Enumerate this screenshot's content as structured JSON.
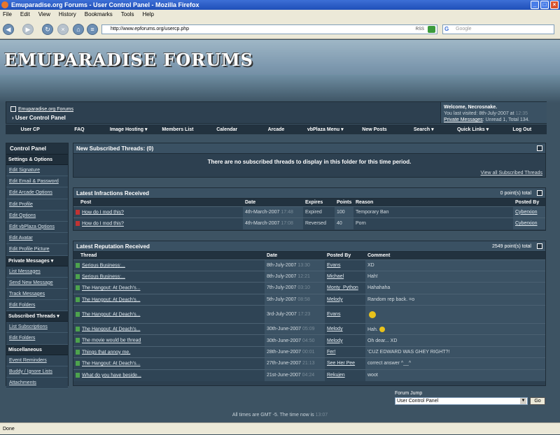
{
  "window": {
    "title": "Emuparadise.org Forums - User Control Panel - Mozilla Firefox"
  },
  "menu": [
    "File",
    "Edit",
    "View",
    "History",
    "Bookmarks",
    "Tools",
    "Help"
  ],
  "address": {
    "url": "http://www.epforums.org/usercp.php",
    "rss": "RSS"
  },
  "search": {
    "placeholder": "Google"
  },
  "banner": {
    "logo": "EMUPARADISE FORUMS"
  },
  "header": {
    "breadcrumb": "Emuparadise.org Forums",
    "page": "User Control Panel",
    "welcome": "Welcome, Necrosnake.",
    "last_visit": "You last visited: 8th-July-2007 at",
    "last_visit_time": "12:35",
    "pm_label": "Private Messages",
    "pm_status": ": Unread 1, Total 134."
  },
  "topnav": [
    "User CP",
    "FAQ",
    "Image Hosting ▾",
    "Members List",
    "Calendar",
    "Arcade",
    "vbPlaza Menu ▾",
    "New Posts",
    "Search ▾",
    "Quick Links ▾",
    "Log Out"
  ],
  "sidebar": {
    "title": "Control Panel",
    "sections": [
      {
        "head": "Settings & Options",
        "items": [
          "Edit Signature",
          "Edit Email & Password",
          "Edit Arcade Options",
          "Edit Profile",
          "Edit Options",
          "Edit vbPlaza Options",
          "Edit Avatar",
          "Edit Profile Picture"
        ]
      },
      {
        "head": "Private Messages ▾",
        "items": [
          "List Messages",
          "Send New Message",
          "Track Messages",
          "Edit Folders"
        ]
      },
      {
        "head": "Subscribed Threads ▾",
        "items": [
          "List Subscriptions",
          "Edit Folders"
        ]
      },
      {
        "head": "Miscellaneous",
        "items": [
          "Event Reminders",
          "Buddy / Ignore Lists",
          "Attachments"
        ]
      }
    ]
  },
  "subscribed": {
    "title": "New Subscribed Threads:",
    "count": "(0)",
    "message": "There are no subscribed threads to display in this folder for this time period.",
    "link": "View all Subscribed Threads"
  },
  "infractions": {
    "title": "Latest Infractions Received",
    "total": "0 point(s) total",
    "cols": [
      "Post",
      "Date",
      "Expires",
      "Points",
      "Reason",
      "Posted By"
    ],
    "rows": [
      [
        "How do I mod this?",
        "4th-March-2007",
        "17:48",
        "Expired",
        "100",
        "Temporary Ban",
        "Cyberxion"
      ],
      [
        "How do I mod this?",
        "4th-March-2007",
        "17:08",
        "Reversed",
        "40",
        "Porn",
        "Cyberxion"
      ]
    ]
  },
  "reputation": {
    "title": "Latest Reputation Received",
    "total": "2549 point(s) total",
    "cols": [
      "Thread",
      "Date",
      "Posted By",
      "Comment"
    ],
    "rows": [
      [
        "Serious Business:...",
        "8th-July-2007",
        "13:30",
        "Evans",
        "XD"
      ],
      [
        "Serious Business:...",
        "8th-July-2007",
        "12:21",
        "Michael",
        "Hah!"
      ],
      [
        "The Hangout: At Deach's...",
        "7th-July-2007",
        "03:10",
        "Monty_Python",
        "Hahahaha"
      ],
      [
        "The Hangout: At Deach's...",
        "5th-July-2007",
        "08:58",
        "Melody",
        "Random rep back. =o"
      ],
      [
        "The Hangout: At Deach's...",
        "3rd-July-2007",
        "17:23",
        "Evans",
        ""
      ],
      [
        "The Hangout: At Deach's...",
        "30th-June-2007",
        "05:09",
        "Melody",
        "Hah."
      ],
      [
        "The movie would be thread",
        "30th-June-2007",
        "04:50",
        "Melody",
        "Oh dear... XD"
      ],
      [
        "Things that annoy me.",
        "28th-June-2007",
        "00:01",
        "Fer!",
        "'CUZ EDWARD WAS GHEY RIGHT?!"
      ],
      [
        "The Hangout: At Deach's...",
        "27th-June-2007",
        "21:13",
        "See Her Pee",
        "correct answer ^__^"
      ],
      [
        "What do you have beside...",
        "21st-June-2007",
        "04:24",
        "Rekujen",
        "woot"
      ]
    ]
  },
  "forumjump": {
    "label": "Forum Jump",
    "selected": "User Control Panel",
    "go": "Go"
  },
  "footer": {
    "text": "All times are GMT -5. The time now is",
    "time": "13:07"
  },
  "status": {
    "text": "Done"
  }
}
